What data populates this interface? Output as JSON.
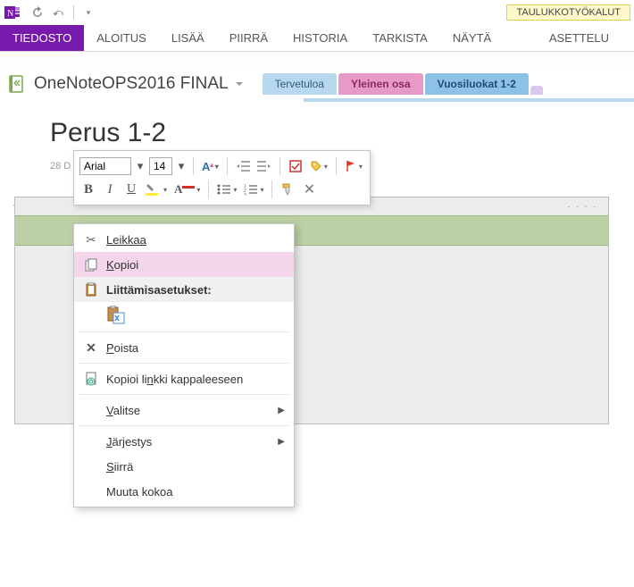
{
  "titlebar": {
    "tool_context": "TAULUKKOTYÖKALUT"
  },
  "ribbon": {
    "file": "TIEDOSTO",
    "tabs": [
      "ALOITUS",
      "LISÄÄ",
      "PIIRRÄ",
      "HISTORIA",
      "TARKISTA",
      "NÄYTÄ"
    ],
    "tool_tab": "ASETTELU"
  },
  "notebook": {
    "title": "OneNoteOPS2016 FINAL"
  },
  "sections": [
    {
      "label": "Tervetuloa"
    },
    {
      "label": "Yleinen osa"
    },
    {
      "label": "Vuosiluokat 1-2"
    }
  ],
  "page": {
    "title": "Perus 1-2",
    "date_fragment": "28 D"
  },
  "mini_toolbar": {
    "font": "Arial",
    "size": "14"
  },
  "context_menu": {
    "cut": "Leikkaa",
    "copy": "Kopioi",
    "paste_options": "Liittämisasetukset:",
    "delete": "Poista",
    "copy_link": "Kopioi linkki kappaleeseen",
    "select": "Valitse",
    "order": "Järjestys",
    "move": "Siirrä",
    "resize": "Muuta kokoa"
  }
}
